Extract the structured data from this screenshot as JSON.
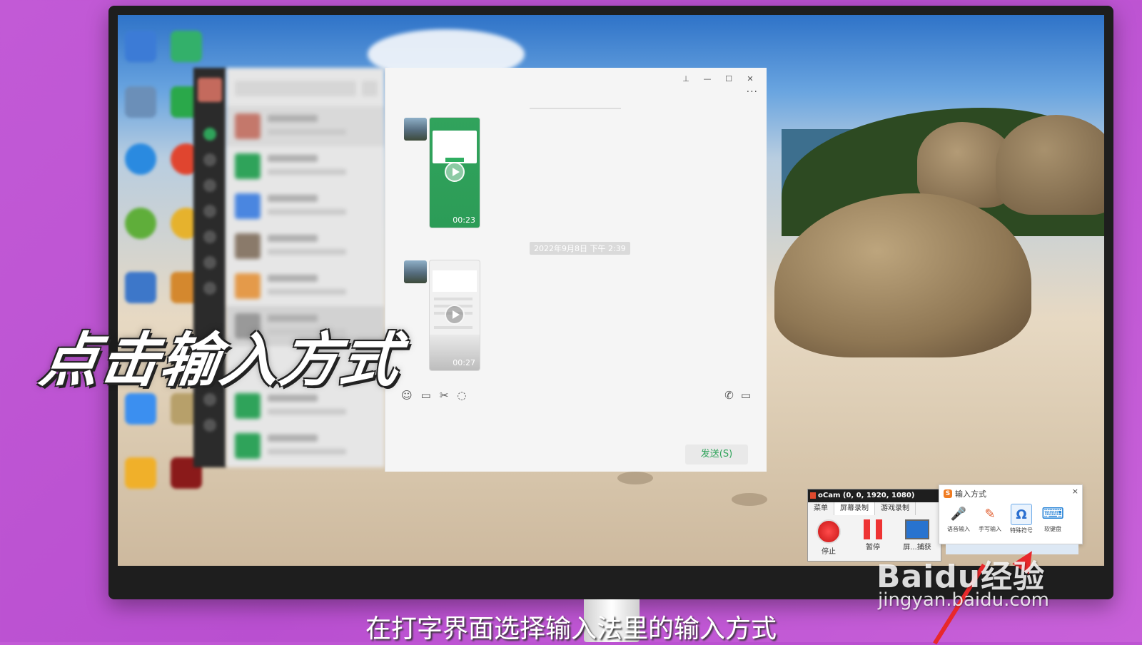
{
  "overlay": {
    "title": "点击输入方式",
    "subtitle": "在打字界面选择输入法里的输入方式"
  },
  "watermark": {
    "logo": "Baidu经验",
    "url": "jingyan.baidu.com"
  },
  "chat": {
    "videos": [
      {
        "duration": "00:23"
      },
      {
        "duration": "00:27"
      }
    ],
    "timestamp": "2022年9月8日 下午 2:39",
    "send_label": "发送(S)",
    "more_label": "···",
    "toolbar_icons": [
      "emoji-icon",
      "folder-icon",
      "scissors-icon",
      "chat-bubble-icon"
    ],
    "toolbar_right_icons": [
      "phone-icon",
      "video-call-icon"
    ],
    "window_buttons": [
      "pin-icon",
      "minimize-icon",
      "maximize-icon",
      "close-icon"
    ]
  },
  "ocam": {
    "title": "oCam (0, 0, 1920, 1080)",
    "tabs": [
      "菜单",
      "屏幕录制",
      "游戏录制"
    ],
    "buttons": [
      "停止",
      "暂停",
      "屏...捕获"
    ]
  },
  "ime": {
    "title": "输入方式",
    "close": "×",
    "items": [
      {
        "label": "语音输入",
        "icon": "microphone-icon",
        "glyph": "🎤"
      },
      {
        "label": "手写输入",
        "icon": "pen-icon",
        "glyph": "✎"
      },
      {
        "label": "特殊符号",
        "icon": "omega-icon",
        "glyph": "Ω"
      },
      {
        "label": "软键盘",
        "icon": "keyboard-icon",
        "glyph": "⌨"
      }
    ]
  },
  "colors": {
    "background": "#c25ad6",
    "wechat_green": "#2fa35a",
    "ocam_red": "#e04a2e",
    "arrow": "#e8282b"
  }
}
